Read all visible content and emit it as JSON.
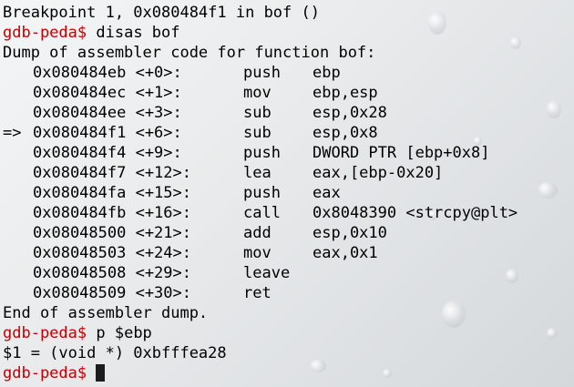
{
  "breakpoint_line": "Breakpoint 1, 0x080484f1 in bof ()",
  "prompt": "gdb-peda$",
  "commands": {
    "disas": "disas bof",
    "print_ebp": "p $ebp"
  },
  "dump_header": "Dump of assembler code for function bof:",
  "disassembly": [
    {
      "marker": "",
      "addr": "0x080484eb <+0>:",
      "mnemonic": "push",
      "operands": "ebp"
    },
    {
      "marker": "",
      "addr": "0x080484ec <+1>:",
      "mnemonic": "mov",
      "operands": "ebp,esp"
    },
    {
      "marker": "",
      "addr": "0x080484ee <+3>:",
      "mnemonic": "sub",
      "operands": "esp,0x28"
    },
    {
      "marker": "=>",
      "addr": "0x080484f1 <+6>:",
      "mnemonic": "sub",
      "operands": "esp,0x8"
    },
    {
      "marker": "",
      "addr": "0x080484f4 <+9>:",
      "mnemonic": "push",
      "operands": "DWORD PTR [ebp+0x8]"
    },
    {
      "marker": "",
      "addr": "0x080484f7 <+12>:",
      "mnemonic": "lea",
      "operands": "eax,[ebp-0x20]"
    },
    {
      "marker": "",
      "addr": "0x080484fa <+15>:",
      "mnemonic": "push",
      "operands": "eax"
    },
    {
      "marker": "",
      "addr": "0x080484fb <+16>:",
      "mnemonic": "call",
      "operands": "0x8048390 <strcpy@plt>"
    },
    {
      "marker": "",
      "addr": "0x08048500 <+21>:",
      "mnemonic": "add",
      "operands": "esp,0x10"
    },
    {
      "marker": "",
      "addr": "0x08048503 <+24>:",
      "mnemonic": "mov",
      "operands": "eax,0x1"
    },
    {
      "marker": "",
      "addr": "0x08048508 <+29>:",
      "mnemonic": "leave",
      "operands": ""
    },
    {
      "marker": "",
      "addr": "0x08048509 <+30>:",
      "mnemonic": "ret",
      "operands": ""
    }
  ],
  "dump_footer": "End of assembler dump.",
  "ebp_result": "$1 = (void *) 0xbfffea28",
  "colors": {
    "prompt": "#c40000",
    "text": "#000000",
    "cursor": "#1c1c1c"
  }
}
